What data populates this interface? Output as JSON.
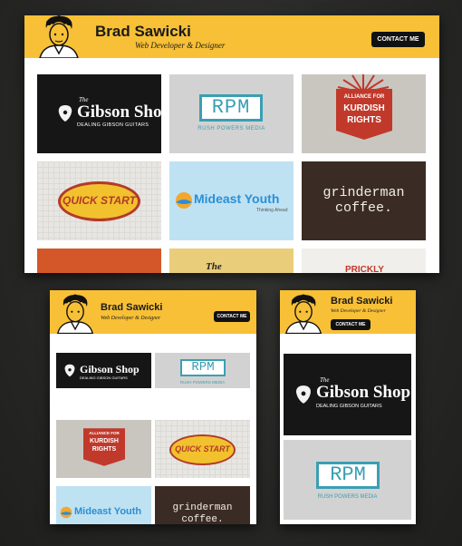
{
  "site": {
    "name": "Brad Sawicki",
    "tagline": "Web Developer & Designer",
    "contact_label": "CONTACT ME"
  },
  "logos": {
    "gibson_small": "The",
    "gibson_main": "Gibson Shop",
    "gibson_sub": "DEALING GIBSON GUITARS",
    "rpm_main": "RPM",
    "rpm_sub": "RUSH POWERS MEDIA",
    "kurd_line1": "ALLIANCE FOR",
    "kurd_line2": "KURDISH",
    "kurd_line3": "RIGHTS",
    "quick_main": "QUICK START",
    "mideast_main": "Mideast Youth",
    "mideast_sub": "Thinking Ahead",
    "grind_line1": "grinderman",
    "grind_line2": "coffee.",
    "tan_text": "The",
    "prickly_text": "PRICKLY"
  },
  "colors": {
    "header": "#f7c036",
    "rpm_teal": "#3a9fb3",
    "kurd_red": "#c0392b",
    "quick_yellow": "#f2c12e",
    "mideast_blue": "#2a8fd6"
  }
}
